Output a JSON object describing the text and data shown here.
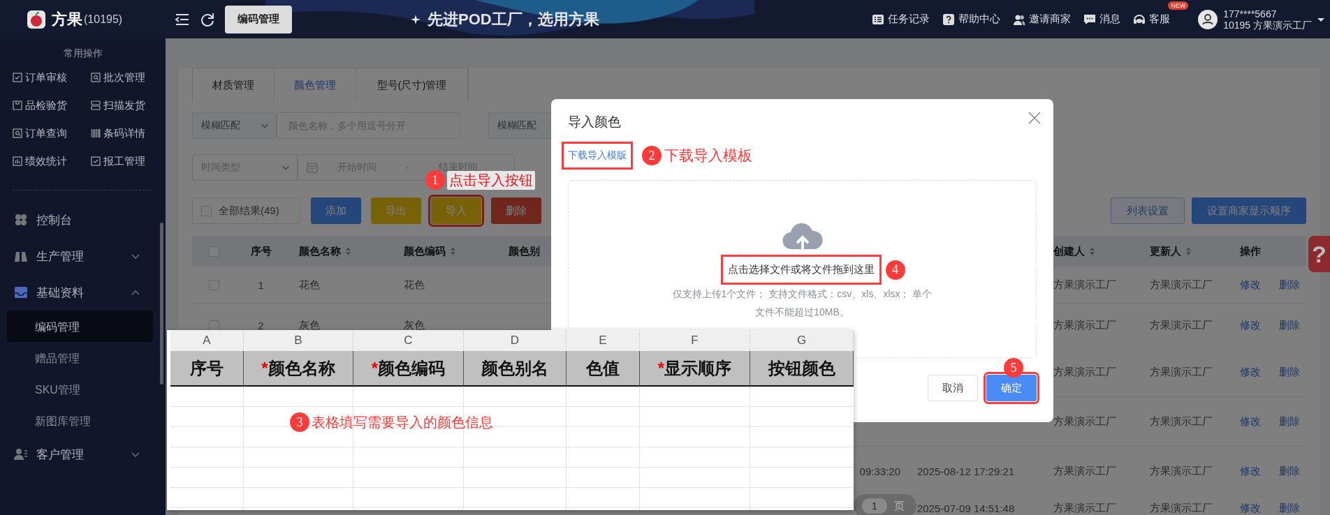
{
  "top_bar": {
    "logo_text": "方果",
    "org_id": "(10195)",
    "page_button": "编码管理",
    "slogan": "先进POD工厂，选用方果",
    "links": [
      {
        "label": "任务记录",
        "kind": "tasks"
      },
      {
        "label": "帮助中心",
        "kind": "help"
      },
      {
        "label": "邀请商家",
        "kind": "invite"
      },
      {
        "label": "消息",
        "kind": "message"
      },
      {
        "label": "客服",
        "kind": "service",
        "badge": "NEW"
      }
    ],
    "user": {
      "phone": "177****5667",
      "org": "10195 方果演示工厂"
    }
  },
  "sidebar": {
    "quick_title": "常用操作",
    "quick_actions": [
      {
        "label": "订单审核",
        "kind": "check"
      },
      {
        "label": "批次管理",
        "kind": "search"
      },
      {
        "label": "品检验货",
        "kind": "box"
      },
      {
        "label": "扫描发货",
        "kind": "scan"
      },
      {
        "label": "订单查询",
        "kind": "search"
      },
      {
        "label": "条码详情",
        "kind": "barcode"
      },
      {
        "label": "绩效统计",
        "kind": "chart"
      },
      {
        "label": "报工管理",
        "kind": "check"
      }
    ],
    "menu": [
      {
        "label": "控制台",
        "kind": "dashboard"
      },
      {
        "label": "生产管理",
        "kind": "production",
        "expanded": false
      },
      {
        "label": "基础资料",
        "kind": "data",
        "expanded": true,
        "children": [
          {
            "label": "编码管理",
            "selected": true
          },
          {
            "label": "赠品管理",
            "selected": false
          },
          {
            "label": "SKU管理",
            "selected": false
          },
          {
            "label": "新图库管理",
            "selected": false
          }
        ]
      },
      {
        "label": "客户管理",
        "kind": "customer",
        "expanded": false
      }
    ]
  },
  "tabs": [
    {
      "label": "材质管理",
      "selected": false
    },
    {
      "label": "颜色管理",
      "selected": true
    },
    {
      "label": "型号(尺寸)管理",
      "selected": false
    }
  ],
  "filters": {
    "name_match": "模糊匹配",
    "name_placeholder": "颜色名称，多个用逗号分开",
    "code_match": "模糊匹配",
    "time_type_placeholder": "时间类型",
    "start_placeholder": "开始时间",
    "separator": "-",
    "end_placeholder": "结束时间"
  },
  "toolbar": {
    "select_all": {
      "label": "全部结果(49)",
      "checked": false
    },
    "buttons": [
      {
        "label": "添加",
        "kind": "primary",
        "highlighted": false
      },
      {
        "label": "导出",
        "kind": "warning",
        "highlighted": false
      },
      {
        "label": "导入",
        "kind": "warning",
        "highlighted": true
      },
      {
        "label": "删除",
        "kind": "danger",
        "highlighted": false
      }
    ],
    "right_buttons": [
      {
        "label": "列表设置",
        "kind": "plain"
      },
      {
        "label": "设置商家显示顺序",
        "kind": "primary"
      }
    ]
  },
  "table": {
    "header_checked": false,
    "columns": [
      {
        "label": "序号",
        "kind": "seq",
        "sortable": false
      },
      {
        "label": "颜色名称",
        "kind": "name",
        "sortable": true
      },
      {
        "label": "颜色编码",
        "kind": "code",
        "sortable": true
      },
      {
        "label": "颜色别",
        "kind": "alias",
        "sortable": false
      },
      {
        "label": "创建人",
        "kind": "creator",
        "sortable": true
      },
      {
        "label": "更新人",
        "kind": "updater",
        "sortable": true
      },
      {
        "label": "操作",
        "kind": "actions",
        "sortable": false
      }
    ],
    "rows": [
      {
        "checked": false,
        "seq": "1",
        "name": "花色",
        "code": "花色",
        "creator": "方果演示工厂",
        "updater": "方果演示工厂",
        "actions": [
          "修改",
          "删除"
        ]
      },
      {
        "checked": false,
        "seq": "2",
        "name": "灰色",
        "code": "灰色",
        "creator": "方果演示工厂",
        "updater": "方果演示工厂",
        "actions": [
          "修改",
          "删除"
        ]
      },
      {
        "creator": "方果演示工厂",
        "updater": "方果演示工厂",
        "actions": [
          "修改",
          "删除"
        ]
      },
      {
        "creator": "方果演示工厂",
        "updater": "方果演示工厂",
        "actions": [
          "修改",
          "删除"
        ]
      },
      {
        "created_time": "09:33:20",
        "updated_time": "2025-08-12 17:29:21",
        "creator": "方果演示工厂",
        "updater": "方果演示工厂",
        "actions": [
          "修改",
          "删除"
        ]
      },
      {
        "updated_time": "2025-07-09 14:51:48",
        "creator": "方果演示工厂",
        "updater": "方果演示工厂",
        "actions": [
          "修改",
          "删除"
        ]
      }
    ]
  },
  "pagination": {
    "page": "1",
    "suffix": "页"
  },
  "help_button": "?",
  "modal": {
    "title": "导入颜色",
    "download_link": {
      "label": "下载导入模版",
      "highlighted": true
    },
    "upload_prompt": {
      "label": "点击选择文件或将文件拖到这里",
      "highlighted": true
    },
    "upload_hint": "仅支持上传1个文件； 支持文件格式：csv、xls、xlsx； 单个文件不能超过10MB。",
    "buttons": [
      {
        "label": "取消",
        "kind": "default",
        "highlighted": false
      },
      {
        "label": "确定",
        "kind": "primary",
        "highlighted": true
      }
    ]
  },
  "spreadsheet": {
    "column_letters": [
      "A",
      "B",
      "C",
      "D",
      "E",
      "F",
      "G"
    ],
    "headers": [
      {
        "label": "序号"
      },
      {
        "label": "颜色名称",
        "required_mark": "*"
      },
      {
        "label": "颜色编码",
        "required_mark": "*"
      },
      {
        "label": "颜色别名"
      },
      {
        "label": "色值"
      },
      {
        "label": "显示顺序",
        "required_mark": "*"
      },
      {
        "label": "按钮颜色"
      }
    ]
  },
  "annotations": [
    {
      "number": "1",
      "text": "点击导入按钮"
    },
    {
      "number": "2",
      "text": "下载导入模板"
    },
    {
      "number": "3",
      "text": "表格填写需要导入的颜色信息"
    },
    {
      "number": "4"
    },
    {
      "number": "5"
    }
  ]
}
